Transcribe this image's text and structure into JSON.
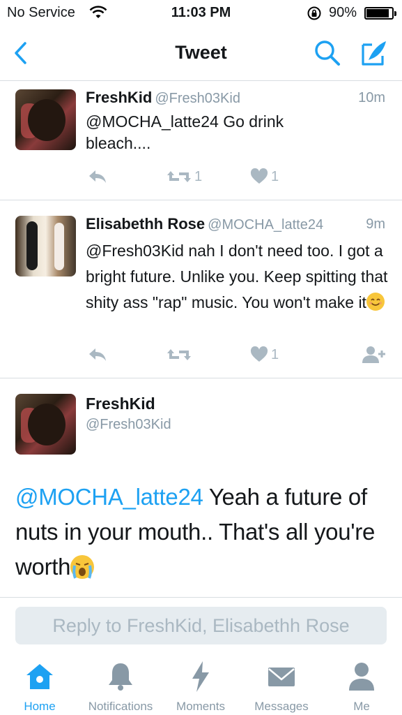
{
  "status_bar": {
    "carrier": "No Service",
    "time": "11:03 PM",
    "battery": "90%",
    "battery_level": 0.9
  },
  "nav": {
    "title": "Tweet",
    "back_icon": "chevron-left-icon",
    "search_icon": "search-icon",
    "compose_icon": "compose-icon",
    "accent": "#1da1f2"
  },
  "tweets": [
    {
      "name": "FreshKid",
      "handle": "@Fresh03Kid",
      "time": "10m",
      "text": "@MOCHA_latte24 Go drink bleach....",
      "retweets": "1",
      "likes": "1"
    },
    {
      "name": "Elisabethh Rose",
      "handle": "@MOCHA_latte24",
      "time": "9m",
      "text": "@Fresh03Kid nah I don't need too. I got a bright future. Unlike you. Keep spitting that shity ass \"rap\" music. You won't make it",
      "emoji": "smiling-face-emoji",
      "likes": "1"
    }
  ],
  "focused_tweet": {
    "name": "FreshKid",
    "handle": "@Fresh03Kid",
    "mention": "@MOCHA_latte24",
    "text": " Yeah a future of nuts in your mouth.. That's all you're worth",
    "emoji": "crying-face-emoji"
  },
  "reply_box": {
    "placeholder": "Reply to FreshKid, Elisabethh Rose"
  },
  "tab_bar": {
    "tabs": [
      {
        "label": "Home",
        "icon": "home-icon",
        "active": true
      },
      {
        "label": "Notifications",
        "icon": "bell-icon",
        "active": false
      },
      {
        "label": "Moments",
        "icon": "lightning-icon",
        "active": false
      },
      {
        "label": "Messages",
        "icon": "envelope-icon",
        "active": false
      },
      {
        "label": "Me",
        "icon": "person-icon",
        "active": false
      }
    ]
  }
}
